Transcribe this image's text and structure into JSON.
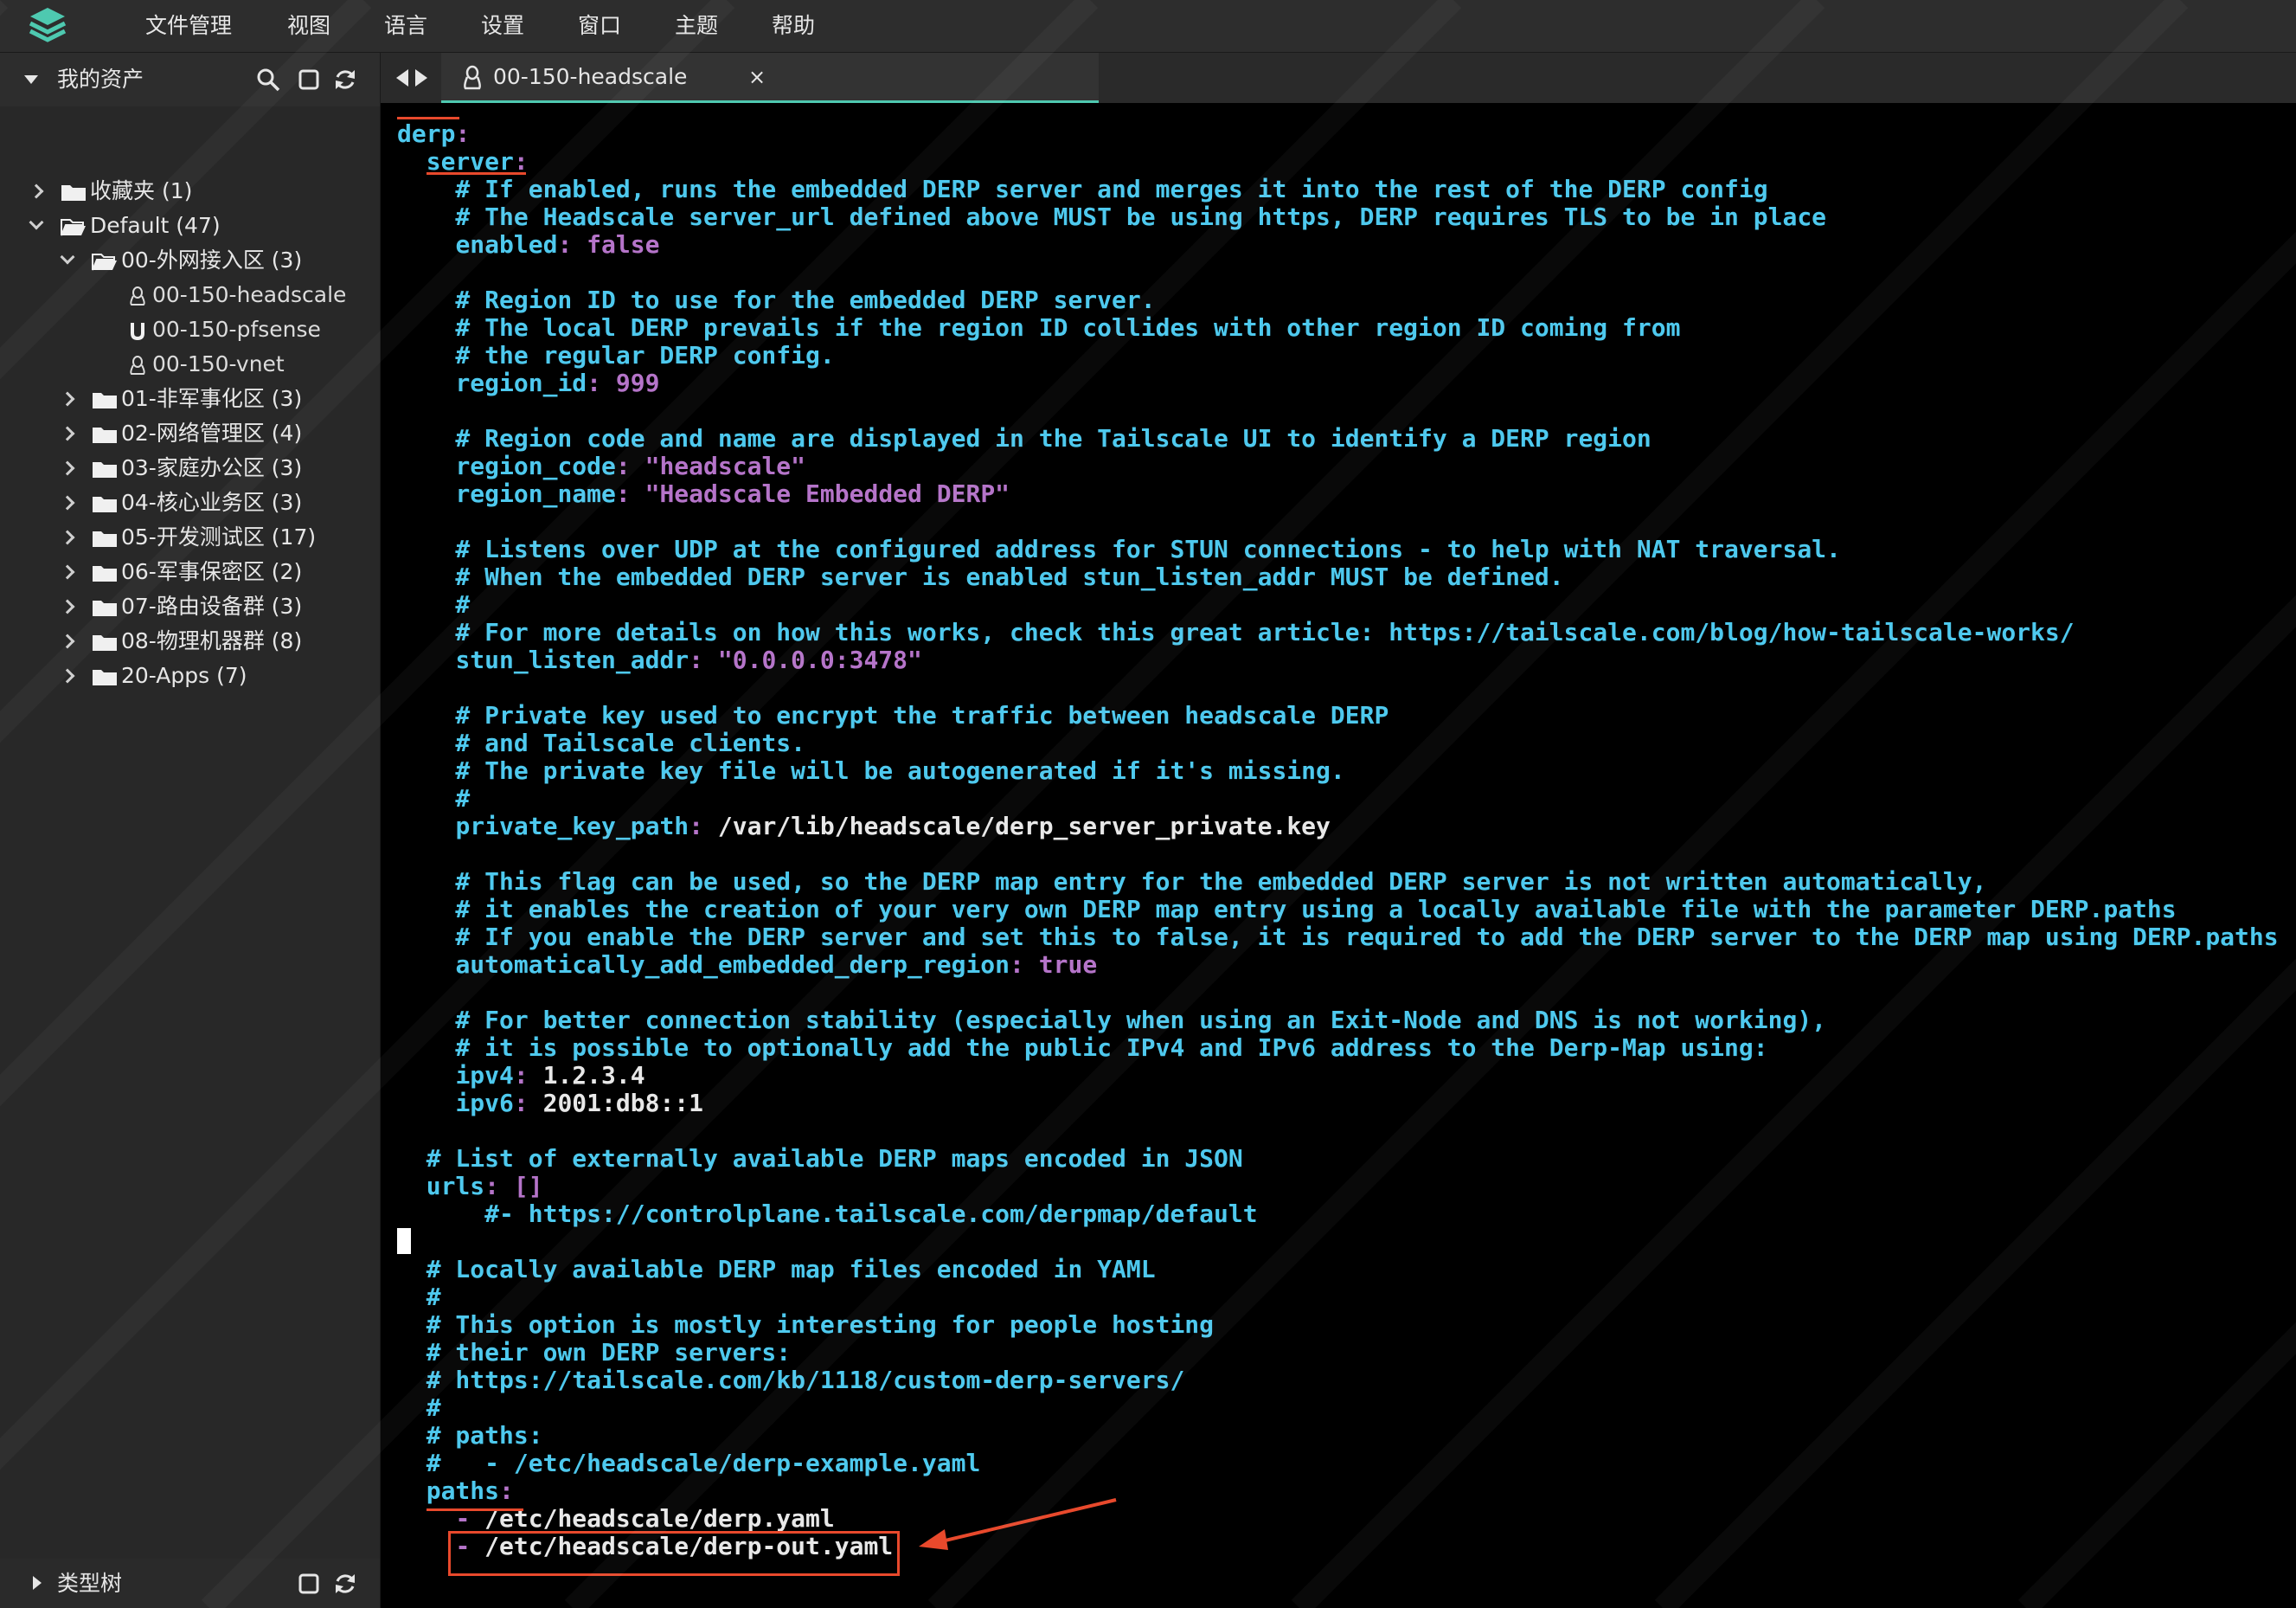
{
  "colors": {
    "accent": "#4ec9b0",
    "annotation": "#e8492c",
    "yaml_key": "#4ec9ee",
    "yaml_value": "#b574c9"
  },
  "menubar": {
    "logo_icon": "stack-layers-icon",
    "items": [
      "文件管理",
      "视图",
      "语言",
      "设置",
      "窗口",
      "主题",
      "帮助"
    ]
  },
  "sidebar": {
    "header": {
      "title": "我的资产",
      "icons": [
        "search-icon",
        "square-icon",
        "refresh-icon"
      ]
    },
    "tree": [
      {
        "label": "收藏夹 (1)",
        "type": "folder",
        "expanded": false
      },
      {
        "label": "Default (47)",
        "type": "folder-open",
        "expanded": true
      },
      {
        "label": "00-外网接入区 (3)",
        "type": "folder-open",
        "expanded": true
      },
      {
        "label": "00-150-headscale",
        "type": "linux-host"
      },
      {
        "label": "00-150-pfsense",
        "type": "unix-host"
      },
      {
        "label": "00-150-vnet",
        "type": "linux-host"
      },
      {
        "label": "01-非军事化区 (3)",
        "type": "folder",
        "expanded": false
      },
      {
        "label": "02-网络管理区 (4)",
        "type": "folder",
        "expanded": false
      },
      {
        "label": "03-家庭办公区 (3)",
        "type": "folder",
        "expanded": false
      },
      {
        "label": "04-核心业务区 (3)",
        "type": "folder",
        "expanded": false
      },
      {
        "label": "05-开发测试区 (17)",
        "type": "folder",
        "expanded": false
      },
      {
        "label": "06-军事保密区 (2)",
        "type": "folder",
        "expanded": false
      },
      {
        "label": "07-路由设备群 (3)",
        "type": "folder",
        "expanded": false
      },
      {
        "label": "08-物理机器群 (8)",
        "type": "folder",
        "expanded": false
      },
      {
        "label": "20-Apps (7)",
        "type": "folder",
        "expanded": false
      }
    ],
    "footer": {
      "title": "类型树"
    }
  },
  "tabs": {
    "nav_icons": [
      "arrow-left-icon",
      "arrow-right-icon"
    ],
    "active": {
      "label": "00-150-headscale",
      "icon": "linux-icon",
      "close": "×"
    }
  },
  "terminal": {
    "lines": [
      [
        {
          "t": "derp",
          "c": "key"
        },
        {
          "t": ":",
          "c": "val"
        }
      ],
      [
        {
          "t": "  "
        },
        {
          "t": "server",
          "c": "key"
        },
        {
          "t": ":",
          "c": "val"
        }
      ],
      [
        {
          "t": "    # If enabled, runs the embedded DERP server and merges it into the rest of the DERP config",
          "c": "com"
        }
      ],
      [
        {
          "t": "    # The Headscale server_url defined above MUST be using https, DERP requires TLS to be in place",
          "c": "com"
        }
      ],
      [
        {
          "t": "    "
        },
        {
          "t": "enabled",
          "c": "key"
        },
        {
          "t": ": ",
          "c": "val"
        },
        {
          "t": "false",
          "c": "val"
        }
      ],
      [
        {
          "t": ""
        }
      ],
      [
        {
          "t": "    # Region ID to use for the embedded DERP server.",
          "c": "com"
        }
      ],
      [
        {
          "t": "    # The local DERP prevails if the region ID collides with other region ID coming from",
          "c": "com"
        }
      ],
      [
        {
          "t": "    # the regular DERP config.",
          "c": "com"
        }
      ],
      [
        {
          "t": "    "
        },
        {
          "t": "region_id",
          "c": "key"
        },
        {
          "t": ": ",
          "c": "val"
        },
        {
          "t": "999",
          "c": "val"
        }
      ],
      [
        {
          "t": ""
        }
      ],
      [
        {
          "t": "    # Region code and name are displayed in the Tailscale UI to identify a DERP region",
          "c": "com"
        }
      ],
      [
        {
          "t": "    "
        },
        {
          "t": "region_code",
          "c": "key"
        },
        {
          "t": ": ",
          "c": "val"
        },
        {
          "t": "\"headscale\"",
          "c": "val"
        }
      ],
      [
        {
          "t": "    "
        },
        {
          "t": "region_name",
          "c": "key"
        },
        {
          "t": ": ",
          "c": "val"
        },
        {
          "t": "\"Headscale Embedded DERP\"",
          "c": "val"
        }
      ],
      [
        {
          "t": ""
        }
      ],
      [
        {
          "t": "    # Listens over UDP at the configured address for STUN connections - to help with NAT traversal.",
          "c": "com"
        }
      ],
      [
        {
          "t": "    # When the embedded DERP server is enabled stun_listen_addr MUST be defined.",
          "c": "com"
        }
      ],
      [
        {
          "t": "    #",
          "c": "com"
        }
      ],
      [
        {
          "t": "    # For more details on how this works, check this great article: https://tailscale.com/blog/how-tailscale-works/",
          "c": "com"
        }
      ],
      [
        {
          "t": "    "
        },
        {
          "t": "stun_listen_addr",
          "c": "key"
        },
        {
          "t": ": ",
          "c": "val"
        },
        {
          "t": "\"0.0.0.0:3478\"",
          "c": "val"
        }
      ],
      [
        {
          "t": ""
        }
      ],
      [
        {
          "t": "    # Private key used to encrypt the traffic between headscale DERP",
          "c": "com"
        }
      ],
      [
        {
          "t": "    # and Tailscale clients.",
          "c": "com"
        }
      ],
      [
        {
          "t": "    # The private key file will be autogenerated if it's missing.",
          "c": "com"
        }
      ],
      [
        {
          "t": "    #",
          "c": "com"
        }
      ],
      [
        {
          "t": "    "
        },
        {
          "t": "private_key_path",
          "c": "key"
        },
        {
          "t": ": ",
          "c": "val"
        },
        {
          "t": "/var/lib/headscale/derp_server_private.key",
          "c": "plain"
        }
      ],
      [
        {
          "t": ""
        }
      ],
      [
        {
          "t": "    # This flag can be used, so the DERP map entry for the embedded DERP server is not written automatically,",
          "c": "com"
        }
      ],
      [
        {
          "t": "    # it enables the creation of your very own DERP map entry using a locally available file with the parameter DERP.paths",
          "c": "com"
        }
      ],
      [
        {
          "t": "    # If you enable the DERP server and set this to false, it is required to add the DERP server to the DERP map using DERP.paths",
          "c": "com"
        }
      ],
      [
        {
          "t": "    "
        },
        {
          "t": "automatically_add_embedded_derp_region",
          "c": "key"
        },
        {
          "t": ": ",
          "c": "val"
        },
        {
          "t": "true",
          "c": "val"
        }
      ],
      [
        {
          "t": ""
        }
      ],
      [
        {
          "t": "    # For better connection stability (especially when using an Exit-Node and DNS is not working),",
          "c": "com"
        }
      ],
      [
        {
          "t": "    # it is possible to optionally add the public IPv4 and IPv6 address to the Derp-Map using:",
          "c": "com"
        }
      ],
      [
        {
          "t": "    "
        },
        {
          "t": "ipv4",
          "c": "key"
        },
        {
          "t": ": ",
          "c": "val"
        },
        {
          "t": "1.2.3.4",
          "c": "plain"
        }
      ],
      [
        {
          "t": "    "
        },
        {
          "t": "ipv6",
          "c": "key"
        },
        {
          "t": ": ",
          "c": "val"
        },
        {
          "t": "2001:db8::1",
          "c": "plain"
        }
      ],
      [
        {
          "t": ""
        }
      ],
      [
        {
          "t": "  # List of externally available DERP maps encoded in JSON",
          "c": "com"
        }
      ],
      [
        {
          "t": "  "
        },
        {
          "t": "urls",
          "c": "key"
        },
        {
          "t": ": ",
          "c": "val"
        },
        {
          "t": "[]",
          "c": "val"
        }
      ],
      [
        {
          "t": "      #- https://controlplane.tailscale.com/derpmap/default",
          "c": "com"
        }
      ],
      [
        {
          "t": "",
          "cursor": true
        }
      ],
      [
        {
          "t": "  # Locally available DERP map files encoded in YAML",
          "c": "com"
        }
      ],
      [
        {
          "t": "  #",
          "c": "com"
        }
      ],
      [
        {
          "t": "  # This option is mostly interesting for people hosting",
          "c": "com"
        }
      ],
      [
        {
          "t": "  # their own DERP servers:",
          "c": "com"
        }
      ],
      [
        {
          "t": "  # https://tailscale.com/kb/1118/custom-derp-servers/",
          "c": "com"
        }
      ],
      [
        {
          "t": "  #",
          "c": "com"
        }
      ],
      [
        {
          "t": "  # paths:",
          "c": "com"
        }
      ],
      [
        {
          "t": "  #   - /etc/headscale/derp-example.yaml",
          "c": "com"
        }
      ],
      [
        {
          "t": "  "
        },
        {
          "t": "paths",
          "c": "key"
        },
        {
          "t": ":",
          "c": "val"
        }
      ],
      [
        {
          "t": "    "
        },
        {
          "t": "- ",
          "c": "val"
        },
        {
          "t": "/etc/headscale/derp.yaml",
          "c": "plain"
        }
      ],
      [
        {
          "t": "    "
        },
        {
          "t": "- ",
          "c": "val"
        },
        {
          "t": "/etc/headscale/derp-out.yaml",
          "c": "plain"
        }
      ]
    ]
  }
}
